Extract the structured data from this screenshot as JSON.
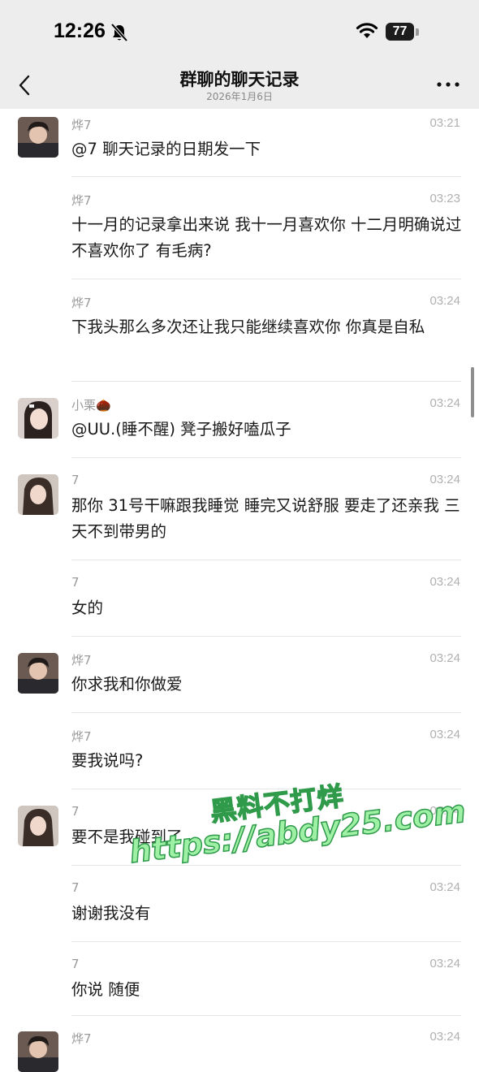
{
  "status_bar": {
    "time": "12:26",
    "battery": "77"
  },
  "header": {
    "title": "群聊的聊天记录",
    "subtitle": "2026年1月6日"
  },
  "messages": [
    {
      "sender": "烨7",
      "time": "03:21",
      "text": "@7 聊天记录的日期发一下",
      "avatar": "avatar-ye7"
    },
    {
      "sender": "烨7",
      "time": "03:23",
      "text": "十一月的记录拿出来说 我十一月喜欢你 十二月明确说过不喜欢你了 有毛病?"
    },
    {
      "sender": "烨7",
      "time": "03:24",
      "text": "下我头那么多次还让我只能继续喜欢你 你真是自私"
    },
    {
      "sender": "小栗",
      "sender_emoji": "🌰",
      "time": "03:24",
      "text": "@UU.(睡不醒) 凳子搬好嗑瓜子",
      "avatar": "avatar-xiaoli"
    },
    {
      "sender": "7",
      "time": "03:24",
      "text": "那你 31号干嘛跟我睡觉 睡完又说舒服 要走了还亲我 三天不到带男的",
      "avatar": "avatar-7"
    },
    {
      "sender": "7",
      "time": "03:24",
      "text": "女的"
    },
    {
      "sender": "烨7",
      "time": "03:24",
      "text": "你求我和你做爱",
      "avatar": "avatar-ye7"
    },
    {
      "sender": "烨7",
      "time": "03:24",
      "text": "要我说吗?"
    },
    {
      "sender": "7",
      "time": "03:24",
      "text": "要不是我碰到了",
      "avatar": "avatar-7"
    },
    {
      "sender": "7",
      "time": "03:24",
      "text": "谢谢我没有"
    },
    {
      "sender": "7",
      "time": "03:24",
      "text": "你说 随便"
    },
    {
      "sender": "烨7",
      "time": "03:24",
      "text": "",
      "avatar": "avatar-ye7"
    }
  ],
  "watermark": {
    "line1": "黑料不打烊",
    "line2": "https://abdy25.com"
  },
  "colors": {
    "header_bg": "#ededed",
    "watermark_fill": "#9ef0a4",
    "watermark_stroke": "#2e9a4a"
  }
}
